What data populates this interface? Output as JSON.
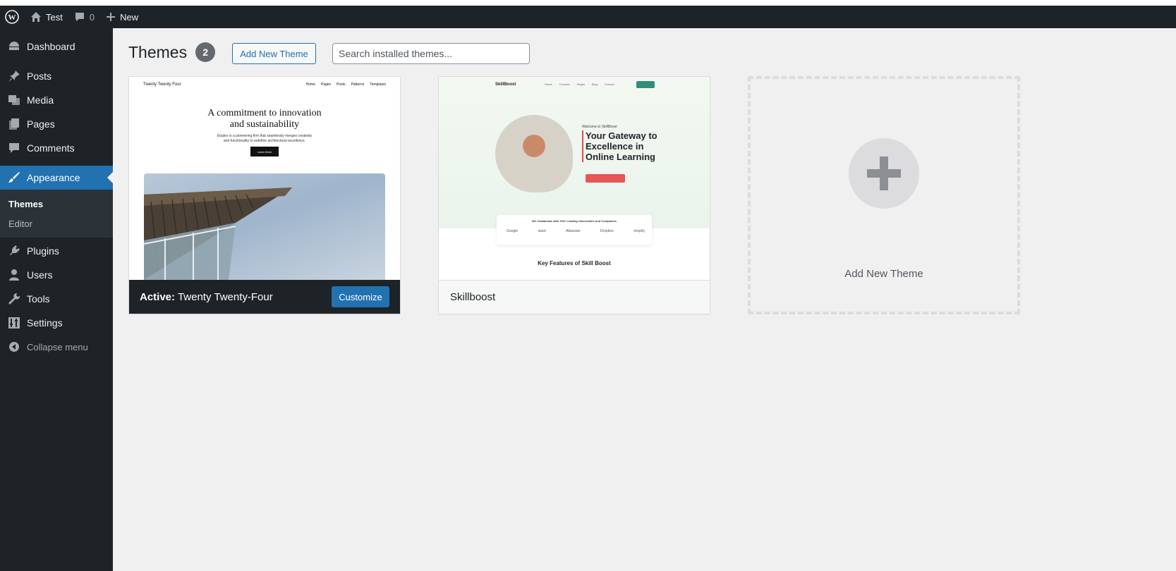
{
  "admin_bar": {
    "site_name": "Test",
    "comment_count": "0",
    "new_label": "New"
  },
  "sidebar": {
    "items": [
      {
        "label": "Dashboard",
        "icon": "dashboard-icon"
      },
      {
        "label": "Posts",
        "icon": "pin-icon"
      },
      {
        "label": "Media",
        "icon": "media-icon"
      },
      {
        "label": "Pages",
        "icon": "pages-icon"
      },
      {
        "label": "Comments",
        "icon": "comment-icon"
      },
      {
        "label": "Appearance",
        "icon": "brush-icon",
        "current": true
      },
      {
        "label": "Plugins",
        "icon": "plug-icon"
      },
      {
        "label": "Users",
        "icon": "user-icon"
      },
      {
        "label": "Tools",
        "icon": "wrench-icon"
      },
      {
        "label": "Settings",
        "icon": "settings-icon"
      }
    ],
    "submenu": [
      {
        "label": "Themes",
        "active": true
      },
      {
        "label": "Editor"
      }
    ],
    "collapse_label": "Collapse menu"
  },
  "main": {
    "title": "Themes",
    "count": "2",
    "add_button": "Add New Theme",
    "search_placeholder": "Search installed themes...",
    "themes": [
      {
        "active_prefix": "Active:",
        "name": "Twenty Twenty-Four",
        "action": "Customize",
        "preview": {
          "brand": "Twenty Twenty Four",
          "links": [
            "Home",
            "Pages",
            "Posts",
            "Patterns",
            "Templates"
          ],
          "headline_1": "A commitment to innovation",
          "headline_2": "and sustainability",
          "sub_1": "Études is a pioneering firm that seamlessly merges creativity",
          "sub_2": "and functionality to redefine architectural excellence.",
          "button": "Learn More"
        }
      },
      {
        "name": "Skillboost",
        "preview": {
          "logo": "SkillBoost",
          "welcome": "Welcome to SkillBoost",
          "headline": "Your Gateway to Excellence in Online Learning",
          "partners_title": "We Collaborate with 100+ Leading Universities And Companies",
          "partners": [
            "Google",
            "slack",
            "Atlassian",
            "Dropbox",
            "shopify"
          ],
          "features": "Key Features of Skill Boost"
        }
      }
    ],
    "add_card_label": "Add New Theme"
  },
  "colors": {
    "admin_dark": "#1d2327",
    "accent": "#2271b1",
    "content_bg": "#f0f0f1"
  }
}
